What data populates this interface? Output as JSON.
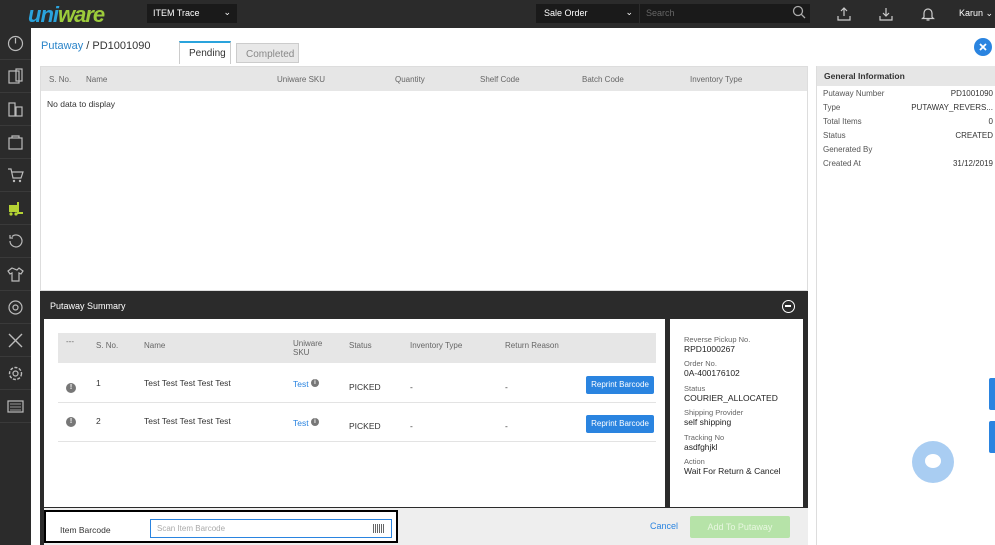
{
  "topbar": {
    "logo": "uniware",
    "search_scope": "ITEM Trace",
    "sale_order": "Sale Order",
    "search_placeholder": "Search",
    "user": "Karun"
  },
  "sidebar": {
    "items": [
      "dashboard-icon",
      "orders-icon",
      "catalog-icon",
      "inventory-icon",
      "cart-icon",
      "forklift-icon",
      "returns-icon",
      "apparel-icon",
      "box-icon",
      "tools-icon",
      "settings-icon",
      "reports-icon"
    ]
  },
  "breadcrumb": {
    "link": "Putaway",
    "separator": "/",
    "current": "PD1001090"
  },
  "tabs": [
    "Pending",
    "Completed"
  ],
  "main_table": {
    "columns": [
      "S. No.",
      "Name",
      "Uniware SKU",
      "Quantity",
      "Shelf Code",
      "Batch Code",
      "Inventory Type"
    ],
    "empty_text": "No data to display"
  },
  "general_info": {
    "title": "General Information",
    "rows": [
      {
        "label": "Putaway Number",
        "value": "PD1001090"
      },
      {
        "label": "Type",
        "value": "PUTAWAY_REVERS..."
      },
      {
        "label": "Total Items",
        "value": "0"
      },
      {
        "label": "Status",
        "value": "CREATED"
      },
      {
        "label": "Generated By",
        "value": ""
      },
      {
        "label": "Created At",
        "value": "31/12/2019"
      }
    ]
  },
  "summary": {
    "title": "Putaway Summary",
    "columns": [
      "---",
      "S. No.",
      "Name",
      "Uniware SKU",
      "Status",
      "Inventory Type",
      "Return Reason"
    ],
    "rows": [
      {
        "sno": "1",
        "name": "Test Test Test Test Test",
        "sku": "Test",
        "status": "PICKED",
        "inventory_type": "-",
        "return_reason": "-",
        "action": "Reprint Barcode"
      },
      {
        "sno": "2",
        "name": "Test Test Test Test Test",
        "sku": "Test",
        "status": "PICKED",
        "inventory_type": "-",
        "return_reason": "-",
        "action": "Reprint Barcode"
      }
    ],
    "details": [
      {
        "label": "Reverse Pickup No.",
        "value": "RPD1000267"
      },
      {
        "label": "Order No.",
        "value": "0A-400176102"
      },
      {
        "label": "Status",
        "value": "COURIER_ALLOCATED"
      },
      {
        "label": "Shipping Provider",
        "value": "self shipping"
      },
      {
        "label": "Tracking No",
        "value": "asdfghjkl"
      },
      {
        "label": "Action",
        "value": "Wait For Return & Cancel"
      }
    ]
  },
  "footer": {
    "barcode_label": "Item Barcode",
    "barcode_placeholder": "Scan Item Barcode",
    "cancel": "Cancel",
    "add": "Add To Putaway"
  }
}
